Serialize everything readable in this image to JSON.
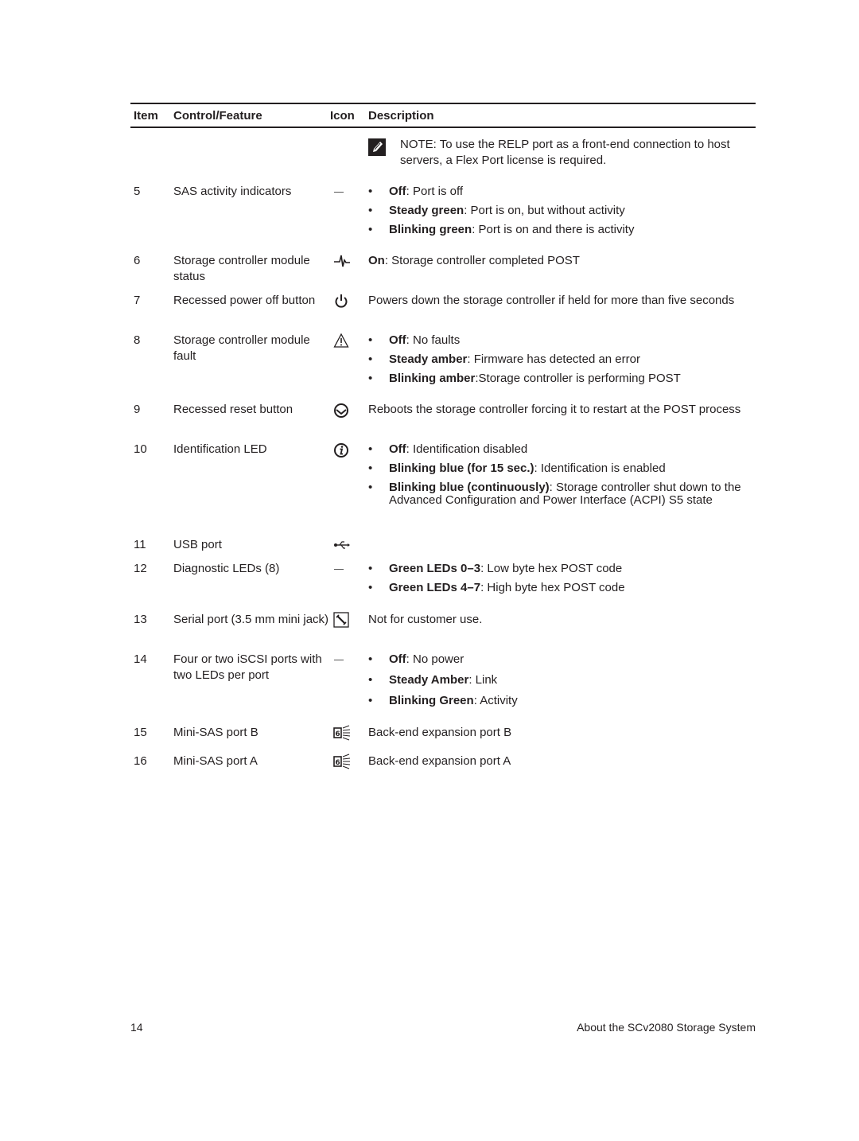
{
  "table": {
    "headers": {
      "item": "Item",
      "feature": "Control/Feature",
      "icon": "Icon",
      "description": "Description"
    },
    "note": {
      "icon": "pencil-note-icon",
      "label": "NOTE:",
      "text": " To use the RELP port as a front-end connection to host servers, a Flex Port license is required."
    },
    "rows": [
      {
        "item": "5",
        "feature": "SAS activity indicators",
        "icon": "dash",
        "bullets": [
          {
            "term": "Off",
            "text": ": Port is off"
          },
          {
            "term": "Steady green",
            "text": ": Port is on, but without activity"
          },
          {
            "term": "Blinking green",
            "text": ": Port is on and there is activity"
          }
        ]
      },
      {
        "item": "6",
        "feature": "Storage controller module status",
        "icon": "heartbeat-icon",
        "term": "On",
        "text": ": Storage controller completed POST"
      },
      {
        "item": "7",
        "feature": "Recessed power off button",
        "icon": "power-icon",
        "text": "Powers down the storage controller if held for more than five seconds"
      },
      {
        "item": "8",
        "feature": "Storage controller module fault",
        "icon": "warning-icon",
        "bullets": [
          {
            "term": "Off",
            "text": ": No faults"
          },
          {
            "term": "Steady amber",
            "text": ": Firmware has detected an error"
          },
          {
            "term": "Blinking amber",
            "text": ":Storage controller is performing POST"
          }
        ]
      },
      {
        "item": "9",
        "feature": "Recessed reset button",
        "icon": "reset-icon",
        "text": "Reboots the storage controller forcing it to restart at the POST process"
      },
      {
        "item": "10",
        "feature": "Identification LED",
        "icon": "identification-icon",
        "bullets": [
          {
            "term": "Off",
            "text": ": Identification disabled"
          },
          {
            "term": "Blinking blue (for 15 sec.)",
            "text": ": Identification is enabled"
          },
          {
            "term": "Blinking blue (continuously)",
            "text": ": Storage controller shut down to the Advanced Configuration and Power Interface (ACPI) S5 state"
          }
        ]
      },
      {
        "item": "11",
        "feature": "USB port",
        "icon": "usb-icon"
      },
      {
        "item": "12",
        "feature": "Diagnostic LEDs (8)",
        "icon": "dash",
        "bullets": [
          {
            "term": "Green LEDs 0–3",
            "text": ": Low byte hex POST code"
          },
          {
            "term": "Green LEDs 4–7",
            "text": ": High byte hex POST code"
          }
        ]
      },
      {
        "item": "13",
        "feature": "Serial port (3.5 mm mini jack)",
        "icon": "wrench-icon",
        "text": "Not for customer use."
      },
      {
        "item": "14",
        "feature": "Four or two iSCSI ports with two LEDs per port",
        "icon": "dash",
        "bullets": [
          {
            "term": "Off",
            "text": ": No power"
          },
          {
            "term": "Steady Amber",
            "text": ": Link"
          },
          {
            "term": "Blinking Green",
            "text": ": Activity"
          }
        ]
      },
      {
        "item": "15",
        "feature": "Mini-SAS port B",
        "icon": "mini-sas-icon",
        "text": "Back-end expansion port B"
      },
      {
        "item": "16",
        "feature": "Mini-SAS port A",
        "icon": "mini-sas-icon",
        "text": "Back-end expansion port A"
      }
    ]
  },
  "footer": {
    "page_number": "14",
    "section_title": "About the SCv2080 Storage System"
  }
}
